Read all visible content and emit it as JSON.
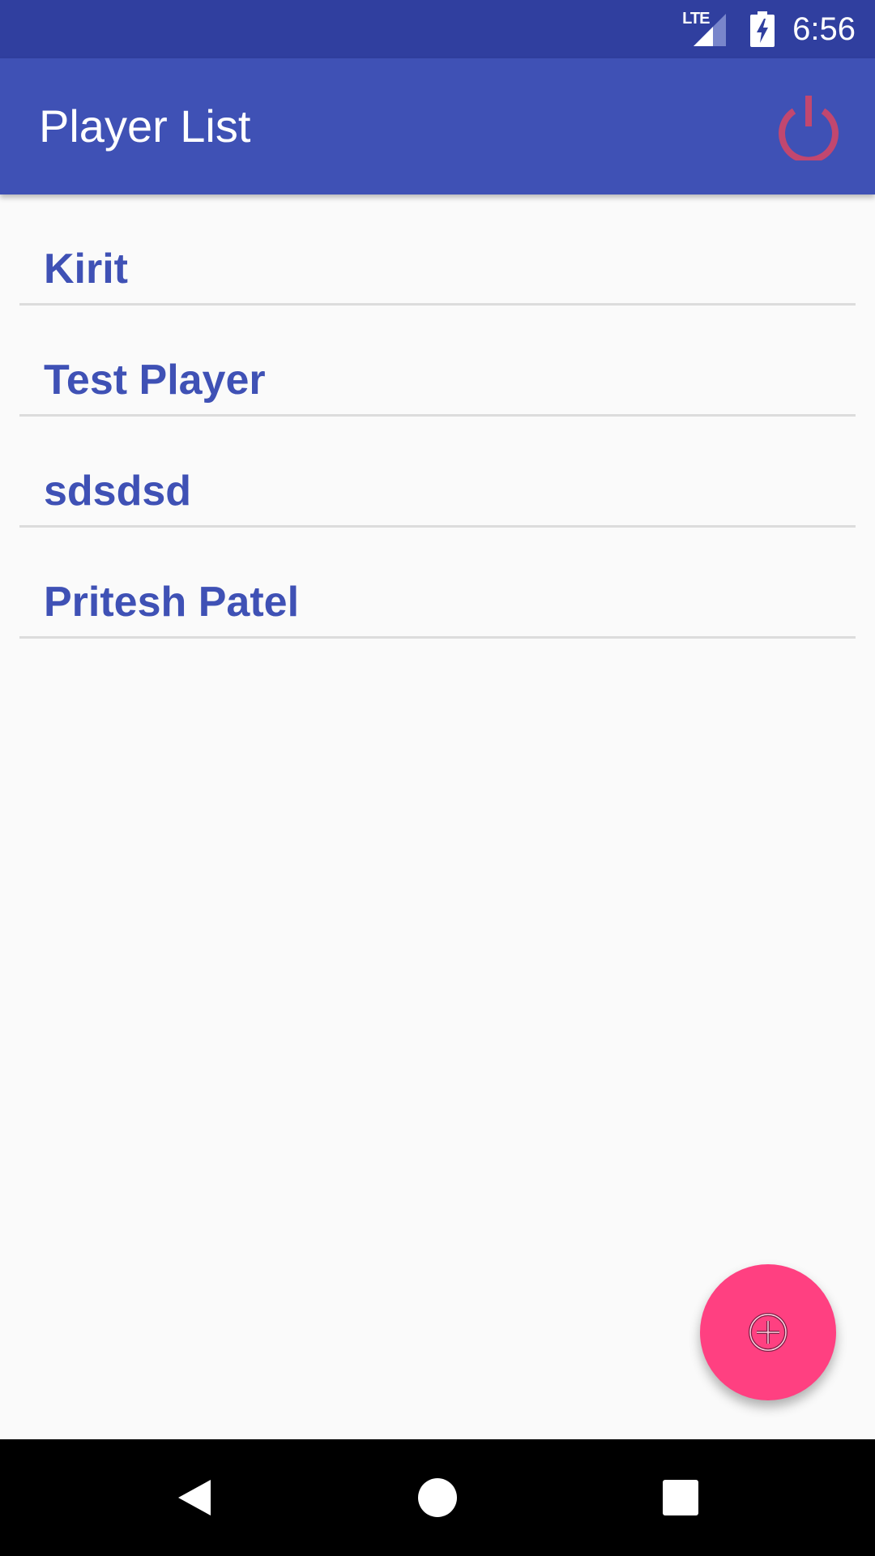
{
  "status_bar": {
    "network_label": "LTE",
    "time": "6:56",
    "icons": [
      "signal-icon",
      "battery-charging-icon"
    ]
  },
  "app_bar": {
    "title": "Player List",
    "action_icon": "power-icon"
  },
  "players": [
    {
      "name": "Kirit"
    },
    {
      "name": "Test Player"
    },
    {
      "name": "sdsdsd"
    },
    {
      "name": "Pritesh Patel"
    }
  ],
  "fab": {
    "icon": "add-circle-icon"
  },
  "nav_bar": {
    "icons": [
      "back-icon",
      "home-icon",
      "recents-icon"
    ]
  },
  "colors": {
    "status_bar": "#303f9f",
    "primary": "#3f51b5",
    "accent": "#ff4081",
    "power_icon": "#c2476f",
    "background": "#fafafa",
    "divider": "#dcdcdc"
  }
}
